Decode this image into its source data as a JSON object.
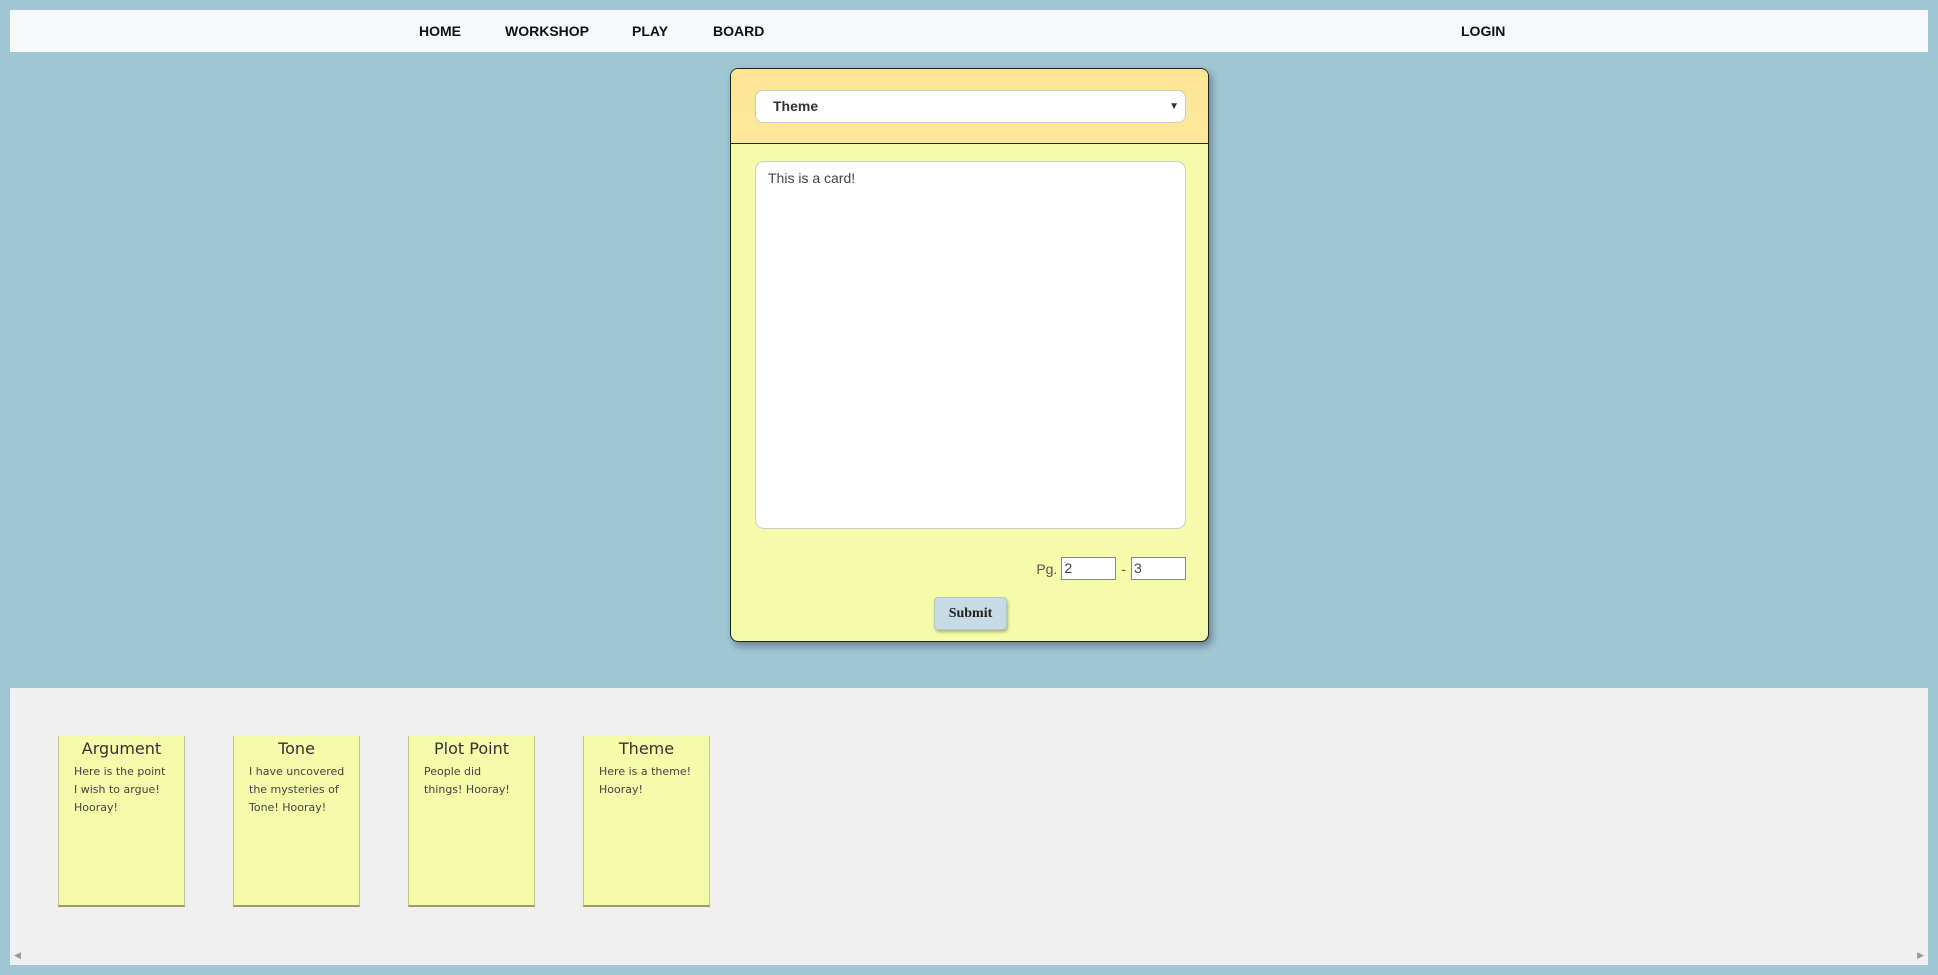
{
  "nav": {
    "links": [
      "HOME",
      "WORKSHOP",
      "PLAY",
      "BOARD"
    ],
    "login": "LOGIN"
  },
  "editor": {
    "select_value": "Theme",
    "text_value": "This is a card!",
    "pg_label": "Pg.",
    "pg_from": "2",
    "pg_sep": "-",
    "pg_to": "3",
    "submit_label": "Submit"
  },
  "board": {
    "cards": [
      {
        "title": "Argument",
        "text": "Here is the point I wish to argue! Hooray!"
      },
      {
        "title": "Tone",
        "text": "I have uncovered the mysteries of Tone! Hooray!"
      },
      {
        "title": "Plot Point",
        "text": "People did things! Hooray!"
      },
      {
        "title": "Theme",
        "text": "Here is a theme! Hooray!"
      }
    ]
  },
  "icons": {
    "select_arrow": "chevron-down-icon",
    "scroll_left": "scroll-left-icon",
    "scroll_right": "scroll-right-icon"
  },
  "colors": {
    "background": "#a0c6d4",
    "card_yellow": "#f4fcaa",
    "header_yellow": "#fde99a"
  }
}
